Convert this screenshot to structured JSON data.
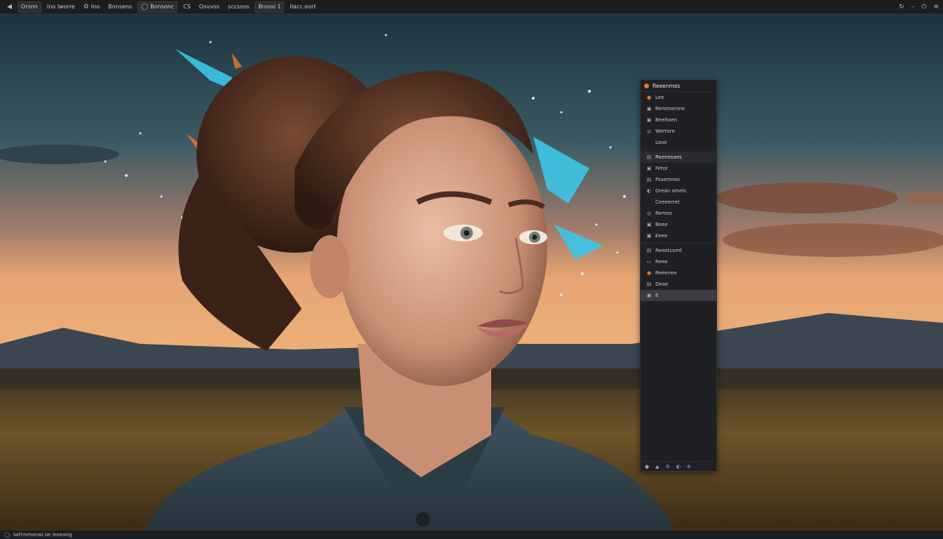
{
  "toolbar": {
    "items": [
      {
        "icon": "back-icon",
        "glyph": "◀",
        "label": ""
      },
      {
        "icon": "",
        "glyph": "",
        "label": "Orsnn"
      },
      {
        "icon": "",
        "glyph": "",
        "label": "Ino Iworre"
      },
      {
        "icon": "settings-icon",
        "glyph": "⚙",
        "label": "Ino"
      },
      {
        "icon": "",
        "glyph": "",
        "label": "Bnnsens"
      },
      {
        "icon": "circle-icon",
        "glyph": "◯",
        "label": "Bonsonc"
      },
      {
        "icon": "",
        "glyph": "",
        "label": "CS"
      },
      {
        "icon": "",
        "glyph": "",
        "label": "Osvvos"
      },
      {
        "icon": "",
        "glyph": "",
        "label": "sccsoss"
      },
      {
        "icon": "",
        "glyph": "",
        "label": "Bnsoo 1"
      },
      {
        "icon": "",
        "glyph": "",
        "label": "Ilacc.eort"
      }
    ],
    "right_icons": [
      "refresh-icon",
      "minimize-icon",
      "power-icon",
      "menu-icon"
    ]
  },
  "panel": {
    "title": "Reeenmes",
    "title_color": "#e8742a",
    "rows": [
      {
        "icon": "●",
        "label": "Lee",
        "type": "row",
        "color": "#e8742a"
      },
      {
        "icon": "▣",
        "label": "Remmenme",
        "type": "row"
      },
      {
        "icon": "▣",
        "label": "Beeltoen",
        "type": "row"
      },
      {
        "icon": "◎",
        "label": "Wertore",
        "type": "row"
      },
      {
        "icon": "",
        "label": "Looe",
        "type": "row"
      },
      {
        "icon": "▤",
        "label": "Reenesaes",
        "type": "group"
      },
      {
        "icon": "▣",
        "label": "Fetor",
        "type": "row"
      },
      {
        "icon": "▤",
        "label": "Pssemnes",
        "type": "row"
      },
      {
        "icon": "◐",
        "label": "Orean smetc",
        "type": "row"
      },
      {
        "icon": "",
        "label": "Ceeeerret",
        "type": "row"
      },
      {
        "icon": "◎",
        "label": "Remes",
        "type": "row"
      },
      {
        "icon": "▣",
        "label": "Beee",
        "type": "row"
      },
      {
        "icon": "▣",
        "label": "Eeee",
        "type": "row"
      },
      {
        "icon": "▤",
        "label": "Reeetcomt",
        "type": "row"
      },
      {
        "icon": "▭",
        "label": "Reee",
        "type": "row"
      },
      {
        "icon": "●",
        "label": "Reeenee",
        "type": "row",
        "color": "#e8742a"
      },
      {
        "icon": "▤",
        "label": "Deae",
        "type": "row"
      },
      {
        "icon": "▣",
        "label": "E",
        "type": "active"
      }
    ],
    "footer_glyphs": [
      "●",
      "▲",
      "⚙",
      "◐",
      "⊕"
    ]
  },
  "status": {
    "icon": "circle-icon",
    "text": "Iwfrmmsnwr.oe Ieeeaeg"
  },
  "colors": {
    "sky_top": "#1f3a47",
    "sky_horizon": "#e8a06a",
    "ground": "#5b4420",
    "splash": "#3cc6e8"
  }
}
